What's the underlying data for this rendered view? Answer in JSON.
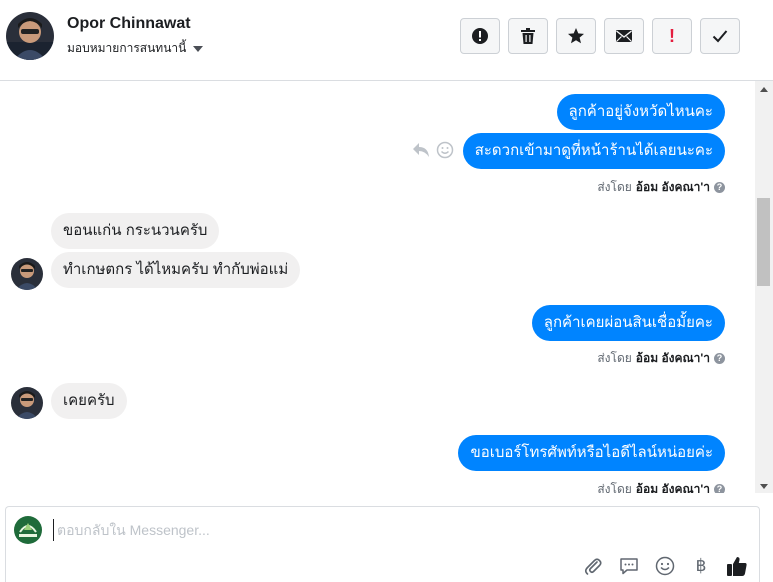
{
  "header": {
    "contact_name": "Opor Chinnawat",
    "assign_label": "มอบหมายการสนทนานี้",
    "toolbar": [
      {
        "name": "spam-button",
        "icon": "alert-icon"
      },
      {
        "name": "delete-button",
        "icon": "trash-icon"
      },
      {
        "name": "star-button",
        "icon": "star-icon"
      },
      {
        "name": "mark-unread-button",
        "icon": "envelope-icon"
      },
      {
        "name": "important-button",
        "icon": "exclamation-icon",
        "text": "!"
      },
      {
        "name": "done-button",
        "icon": "check-icon"
      }
    ]
  },
  "messages": {
    "m1": "ลูกค้าอยู่จังหวัดไหนคะ",
    "m2": "สะดวกเข้ามาดูที่หน้าร้านได้เลยนะคะ",
    "sent_prefix": "ส่งโดย",
    "sender": "อ้อม อังคณา'า",
    "m3": "ขอนแก่น กระนวนครับ",
    "m4": "ทำเกษตกร ได้ไหมครับ ทำกับพ่อแม่",
    "m5": "ลูกค้าเคยผ่อนสินเชื่อมั้ยคะ",
    "m6": "เคยครับ",
    "m7": "ขอเบอร์โทรศัพท์หรือไอดีไลน์หน่อยค่ะ",
    "help_mark": "?"
  },
  "composer": {
    "placeholder": "ตอบกลับใน Messenger...",
    "value": "",
    "baht_symbol": "฿"
  },
  "colors": {
    "outgoing": "#0084ff",
    "incoming": "#f1f0f0",
    "important": "#e41e3f"
  }
}
